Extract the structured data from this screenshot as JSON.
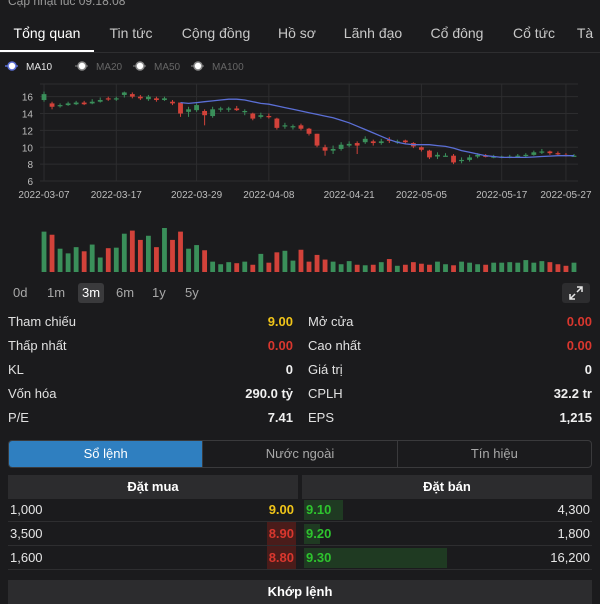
{
  "header": {
    "updated_text": "Cập nhật lúc 09:18:08"
  },
  "tabs": [
    "Tổng quan",
    "Tin tức",
    "Cộng đồng",
    "Hồ sơ",
    "Lãnh đạo",
    "Cổ đông",
    "Cổ tức",
    "Tà"
  ],
  "chart_data": {
    "type": "candlestick",
    "legend": [
      {
        "name": "MA10",
        "active": true,
        "color": "#5b6fd6"
      },
      {
        "name": "MA20",
        "active": false
      },
      {
        "name": "MA50",
        "active": false
      },
      {
        "name": "MA100",
        "active": false
      }
    ],
    "y_ticks": [
      16,
      14,
      12,
      10,
      8,
      6
    ],
    "ylim": [
      6,
      17.5
    ],
    "x_ticks": [
      "2022-03-07",
      "2022-03-17",
      "2022-03-29",
      "2022-04-08",
      "2022-04-21",
      "2022-05-05",
      "2022-05-17",
      "2022-05-27"
    ],
    "colors": {
      "up": "#3a8f5a",
      "down": "#d2423a",
      "ma": "#5b6fd6"
    },
    "candles": [
      [
        15.6,
        16.3,
        16.6,
        15.4
      ],
      [
        15.2,
        14.8,
        15.4,
        14.5
      ],
      [
        14.9,
        15.0,
        15.2,
        14.7
      ],
      [
        15.0,
        15.2,
        15.4,
        14.9
      ],
      [
        15.1,
        15.3,
        15.5,
        15.0
      ],
      [
        15.3,
        15.1,
        15.5,
        15.0
      ],
      [
        15.2,
        15.4,
        15.7,
        15.1
      ],
      [
        15.4,
        15.6,
        15.9,
        15.3
      ],
      [
        15.8,
        15.7,
        16.0,
        15.5
      ],
      [
        15.7,
        15.8,
        16.0,
        15.5
      ],
      [
        16.2,
        16.5,
        16.6,
        15.9
      ],
      [
        16.3,
        16.0,
        16.5,
        15.8
      ],
      [
        16.0,
        15.8,
        16.2,
        15.6
      ],
      [
        15.7,
        16.0,
        16.2,
        15.5
      ],
      [
        15.8,
        15.6,
        16.0,
        15.4
      ],
      [
        15.6,
        15.8,
        16.0,
        15.5
      ],
      [
        15.4,
        15.2,
        15.6,
        15.0
      ],
      [
        15.3,
        14.0,
        15.3,
        13.6
      ],
      [
        14.2,
        14.5,
        14.8,
        13.6
      ],
      [
        14.4,
        15.0,
        15.2,
        14.2
      ],
      [
        14.3,
        13.8,
        14.5,
        12.6
      ],
      [
        13.7,
        14.5,
        14.8,
        13.5
      ],
      [
        14.5,
        14.6,
        14.8,
        14.2
      ],
      [
        14.5,
        14.6,
        14.8,
        14.2
      ],
      [
        14.6,
        14.4,
        14.9,
        14.3
      ],
      [
        14.2,
        14.3,
        14.5,
        13.8
      ],
      [
        14.0,
        13.4,
        14.1,
        13.2
      ],
      [
        13.6,
        13.8,
        14.1,
        13.4
      ],
      [
        13.7,
        13.6,
        14.0,
        13.4
      ],
      [
        13.4,
        12.3,
        13.5,
        12.1
      ],
      [
        12.5,
        12.6,
        12.9,
        12.2
      ],
      [
        12.4,
        12.5,
        12.7,
        12.1
      ],
      [
        12.6,
        12.2,
        12.8,
        12.0
      ],
      [
        12.2,
        11.6,
        12.3,
        11.4
      ],
      [
        11.6,
        10.2,
        11.6,
        10.0
      ],
      [
        10.0,
        9.6,
        10.3,
        9.0
      ],
      [
        9.6,
        9.8,
        10.2,
        9.2
      ],
      [
        9.8,
        10.3,
        10.6,
        9.6
      ],
      [
        10.2,
        10.4,
        10.7,
        10.0
      ],
      [
        10.5,
        10.2,
        10.7,
        9.2
      ],
      [
        10.6,
        11.0,
        11.3,
        10.4
      ],
      [
        10.7,
        10.5,
        10.9,
        10.2
      ],
      [
        10.5,
        10.7,
        11.0,
        10.3
      ],
      [
        10.9,
        10.8,
        11.2,
        10.5
      ],
      [
        10.6,
        10.7,
        10.9,
        10.4
      ],
      [
        10.8,
        10.6,
        10.9,
        10.4
      ],
      [
        10.5,
        10.1,
        10.6,
        9.9
      ],
      [
        10.0,
        9.7,
        10.1,
        9.5
      ],
      [
        9.6,
        8.8,
        9.7,
        8.6
      ],
      [
        8.9,
        9.1,
        9.4,
        8.6
      ],
      [
        9.0,
        9.0,
        9.3,
        8.9
      ],
      [
        9.0,
        8.2,
        9.2,
        8.0
      ],
      [
        8.4,
        8.5,
        8.8,
        8.1
      ],
      [
        8.5,
        8.8,
        9.1,
        8.3
      ],
      [
        8.9,
        9.1,
        9.3,
        8.7
      ],
      [
        9.0,
        8.9,
        9.2,
        8.8
      ],
      [
        8.9,
        8.9,
        9.1,
        8.7
      ],
      [
        8.8,
        8.9,
        9.0,
        8.7
      ],
      [
        8.9,
        8.9,
        9.1,
        8.7
      ],
      [
        9.0,
        9.0,
        9.2,
        8.8
      ],
      [
        9.0,
        9.1,
        9.3,
        8.8
      ],
      [
        9.1,
        9.4,
        9.6,
        9.0
      ],
      [
        9.4,
        9.5,
        9.8,
        9.2
      ],
      [
        9.5,
        9.3,
        9.6,
        9.1
      ],
      [
        9.3,
        9.2,
        9.5,
        9.0
      ],
      [
        9.1,
        9.0,
        9.3,
        8.9
      ],
      [
        9.0,
        9.0,
        9.2,
        8.9
      ]
    ],
    "ma10": [
      15.3,
      15.2,
      15.3,
      15.4,
      15.5,
      15.6,
      15.7,
      15.7,
      15.6,
      15.4,
      15.2,
      15.1,
      14.9,
      14.7,
      14.5,
      14.3,
      14.1,
      13.9,
      13.7,
      13.5,
      13.2,
      12.9,
      12.5,
      12.1,
      11.7,
      11.3,
      10.9,
      10.6,
      10.4,
      10.3,
      10.3,
      10.3,
      10.2,
      10.1,
      9.9,
      9.6,
      9.4,
      9.2,
      9.0,
      8.9,
      8.8,
      8.8,
      8.8,
      8.8,
      8.85,
      8.9,
      8.95,
      9.0,
      9.0,
      9.0
    ]
  },
  "volume": {
    "values": [
      78,
      72,
      45,
      36,
      48,
      40,
      53,
      28,
      46,
      47,
      74,
      80,
      62,
      70,
      48,
      85,
      62,
      78,
      45,
      52,
      42,
      20,
      15,
      19,
      17,
      20,
      14,
      35,
      18,
      38,
      41,
      22,
      43,
      20,
      33,
      24,
      20,
      15,
      21,
      14,
      13,
      14,
      19,
      25,
      12,
      14,
      19,
      16,
      14,
      20,
      15,
      13,
      20,
      18,
      15,
      14,
      18,
      18,
      19,
      18,
      23,
      18,
      21,
      19,
      15,
      12,
      18
    ]
  },
  "ranges": [
    "0d",
    "1m",
    "3m",
    "6m",
    "1y",
    "5y"
  ],
  "active_range": "3m",
  "stats": {
    "left": [
      {
        "label": "Tham chiếu",
        "value": "9.00",
        "color": "yellow"
      },
      {
        "label": "Thấp nhất",
        "value": "0.00",
        "color": "red"
      },
      {
        "label": "KL",
        "value": "0",
        "color": ""
      },
      {
        "label": "Vốn hóa",
        "value": "290.0 tỷ",
        "color": ""
      },
      {
        "label": "P/E",
        "value": "7.41",
        "color": ""
      }
    ],
    "right": [
      {
        "label": "Mở cửa",
        "value": "0.00",
        "color": "red"
      },
      {
        "label": "Cao nhất",
        "value": "0.00",
        "color": "red"
      },
      {
        "label": "Giá trị",
        "value": "0",
        "color": ""
      },
      {
        "label": "CPLH",
        "value": "32.2 tr",
        "color": ""
      },
      {
        "label": "EPS",
        "value": "1,215",
        "color": ""
      }
    ]
  },
  "segments": [
    "Sổ lệnh",
    "Nước ngoài",
    "Tín hiệu"
  ],
  "active_segment": "Sổ lệnh",
  "orderbook": {
    "buy_title": "Đặt mua",
    "sell_title": "Đặt bán",
    "buy": [
      {
        "qty": "1,000",
        "price": "9.00",
        "color": "yellow"
      },
      {
        "qty": "3,500",
        "price": "8.90",
        "color": "red"
      },
      {
        "qty": "1,600",
        "price": "8.80",
        "color": "red"
      }
    ],
    "sell": [
      {
        "price": "9.10",
        "qty": "4,300",
        "color": "green",
        "depth": 0.27
      },
      {
        "price": "9.20",
        "qty": "1,800",
        "color": "green",
        "depth": 0.11
      },
      {
        "price": "9.30",
        "qty": "16,200",
        "color": "green",
        "depth": 1.0
      }
    ]
  },
  "matched_title": "Khớp lệnh"
}
